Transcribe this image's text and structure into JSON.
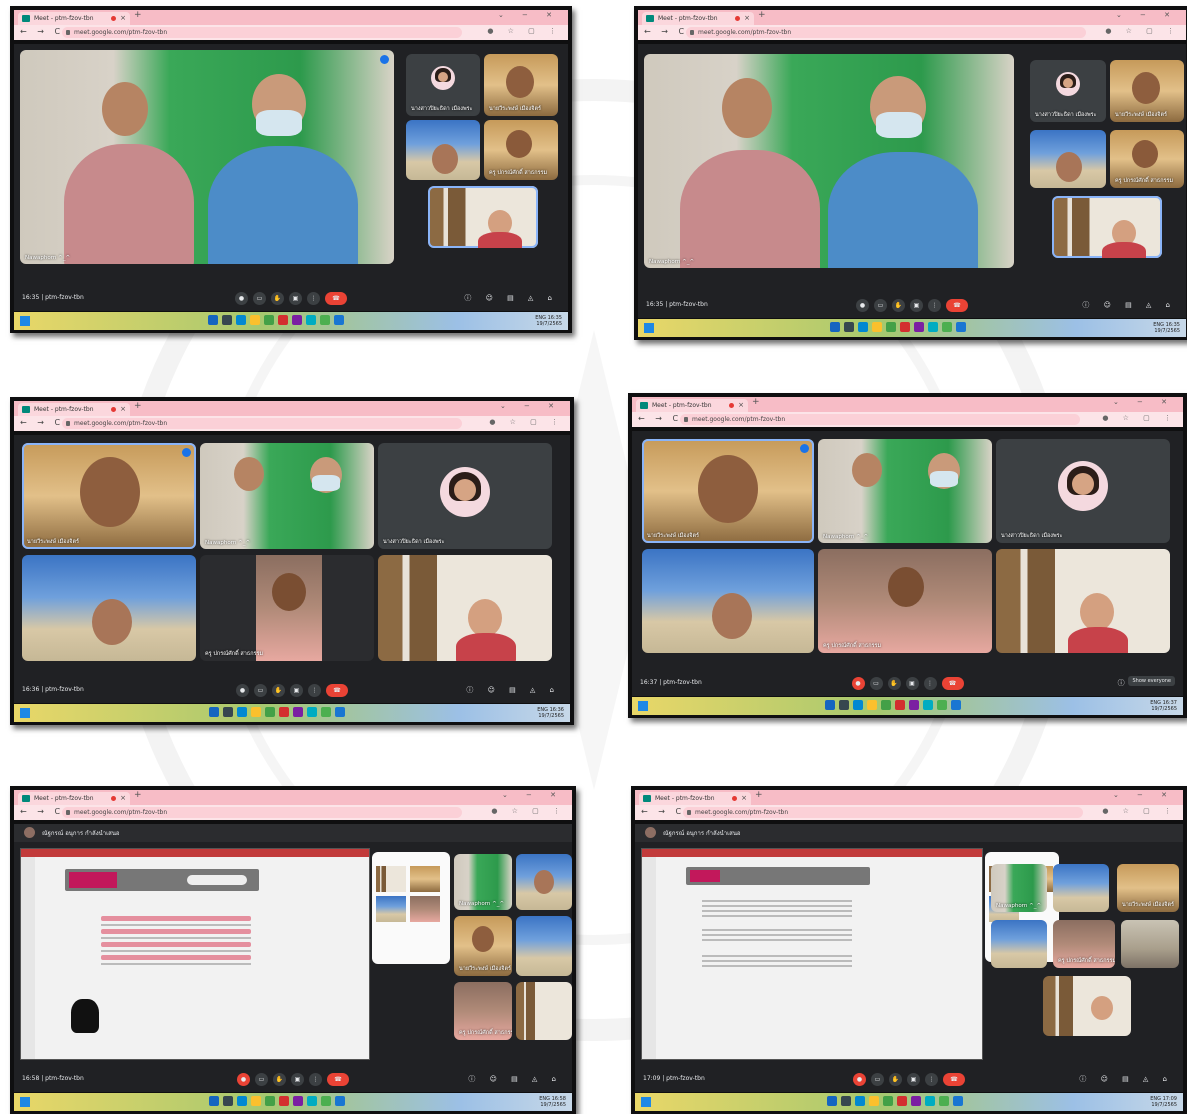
{
  "meeting_title": "Meet - ptm-fzov-tbn",
  "url": "meet.google.com/ptm-fzov-tbn",
  "meeting_code": "ptm-fzov-tbn",
  "icons": [
    "back-arrow-icon",
    "forward-arrow-icon",
    "reload-icon",
    "lock-icon",
    "star-icon",
    "mic-icon",
    "camera-icon",
    "raise-hand-icon",
    "present-icon",
    "more-icon",
    "end-call-icon",
    "info-icon",
    "people-icon",
    "chat-icon",
    "activities-icon",
    "host-controls-icon",
    "windows-start-icon"
  ],
  "colors": {
    "tab_strip": "#f7bcc6",
    "end_call": "#ea4335",
    "meet_bg": "#202124",
    "active_border": "#8ab4f8"
  },
  "participants": {
    "nawaphorn": "Nawaphorn ^_^",
    "kobkarn": "นางสาวปิยะธิดา เมืองพระ",
    "nakarin": "นายวีระพงษ์ เมืองจิตร์",
    "teacher": "ครู ปกรณ์ศักดิ์ สาธกรรม"
  },
  "screenshots": [
    {
      "time": "16:35"
    },
    {
      "time": "16:35"
    },
    {
      "time": "16:36"
    },
    {
      "time": "16:37",
      "tooltip": "Show everyone"
    },
    {
      "time": "16:58",
      "presenter": "ณัฐกรณ์ อนุการ กำลังนำเสนอ"
    },
    {
      "time": "17:09",
      "presenter": "ณัฐกรณ์ อนุการ กำลังนำเสนอ"
    }
  ],
  "taskbar": {
    "lang": "ENG",
    "date": "19/7/2565"
  }
}
